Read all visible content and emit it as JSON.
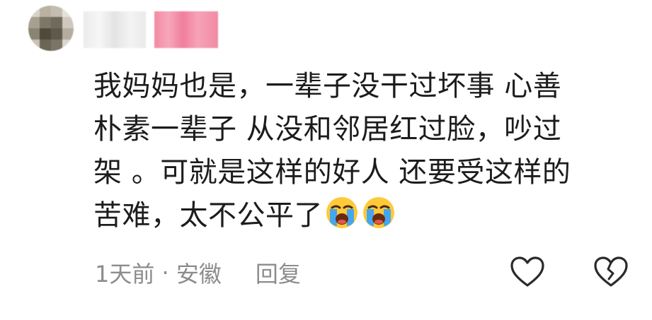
{
  "comment": {
    "lines": [
      "我妈妈也是，一辈子没干过坏事  心善",
      "朴素一辈子 从没和邻居红过脸，吵过",
      "架 。可就是这样的好人 还要受这样的",
      "苦难，太不公平了"
    ],
    "emojis": [
      "loudly-crying-face",
      "loudly-crying-face"
    ]
  },
  "meta": {
    "time": "1天前",
    "separator": " · ",
    "location": "安徽",
    "reply_label": "回复"
  },
  "actions": {
    "like_icon": "heart-outline-icon",
    "dislike_icon": "broken-heart-outline-icon"
  },
  "colors": {
    "text": "#1c1c1c",
    "meta_text": "#8c8c8c",
    "username_blur": "#f28aa4",
    "emoji_face": "#ffc93a",
    "emoji_tears": "#45a6f0"
  }
}
